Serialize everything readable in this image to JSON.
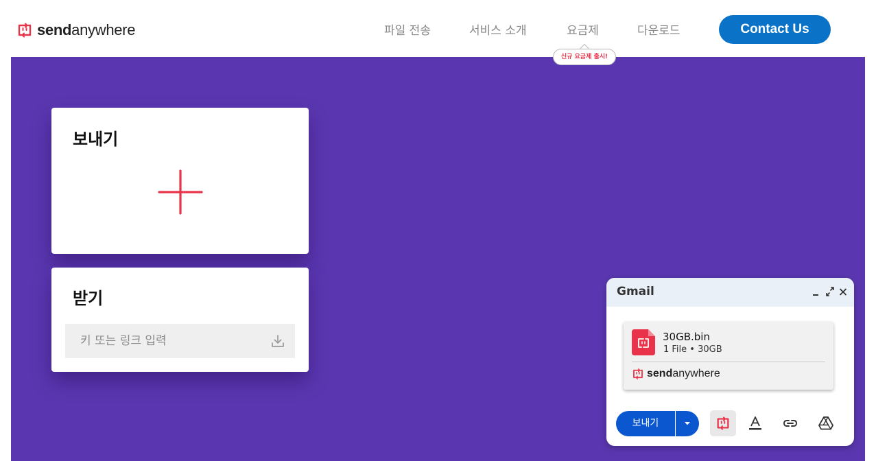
{
  "brand": {
    "bold": "send",
    "light": "anywhere",
    "accent": "#e8334a"
  },
  "nav": {
    "items": [
      "파일 전송",
      "서비스 소개",
      "요금제",
      "다운로드"
    ],
    "badge": "신규 요금제 출시!",
    "contact_label": "Contact Us",
    "contact_color": "#0a73c7"
  },
  "background_color": "#5a37b0",
  "send_card": {
    "title": "보내기",
    "add_icon": "plus-icon"
  },
  "receive_card": {
    "title": "받기",
    "placeholder": "키 또는 링크 입력",
    "submit_icon": "download-icon"
  },
  "gmail": {
    "title": "Gmail",
    "controls": {
      "minimize": "minimize-icon",
      "expand": "expand-icon",
      "close": "close-icon"
    },
    "attachment": {
      "file_name": "30GB.bin",
      "meta": "1 File • 30GB",
      "brand_bold": "send",
      "brand_light": "anywhere"
    },
    "send_label": "보내기",
    "send_color": "#0b57d0",
    "toolbar_icons": [
      "sendanywhere-icon",
      "text-format-icon",
      "link-icon",
      "google-drive-icon"
    ]
  }
}
